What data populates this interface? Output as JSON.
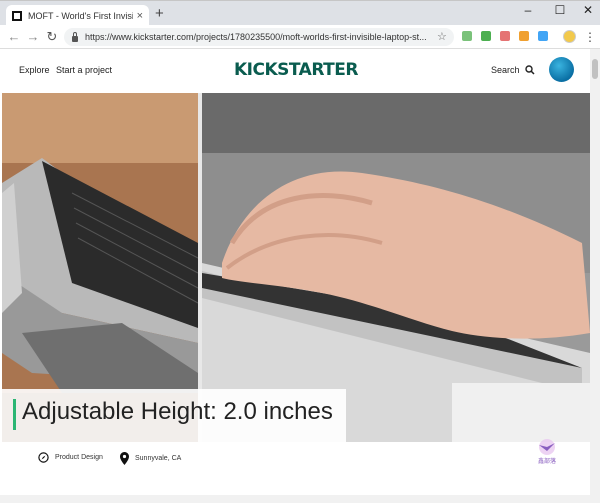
{
  "browser": {
    "tab_title": "MOFT - World's First Invisible L",
    "url": "https://www.kickstarter.com/projects/1780235500/moft-worlds-first-invisible-laptop-st...",
    "new_tab": "+",
    "close_tab": "×",
    "window_controls": [
      "–",
      "☐",
      "✕"
    ]
  },
  "header": {
    "explore": "Explore",
    "start_project": "Start a project",
    "logo": "KICKSTARTER",
    "search": "Search"
  },
  "video": {
    "caption": "Adjustable Height: 2.0 inches"
  },
  "project_meta": {
    "category": "Product Design",
    "location": "Sunnyvale, CA"
  },
  "watermark": {
    "text": "鑫部落"
  },
  "colors": {
    "brand_dark": "#0a5c4f",
    "accent_green": "#2bb673",
    "avatar_blue": "#1a8fc4"
  }
}
